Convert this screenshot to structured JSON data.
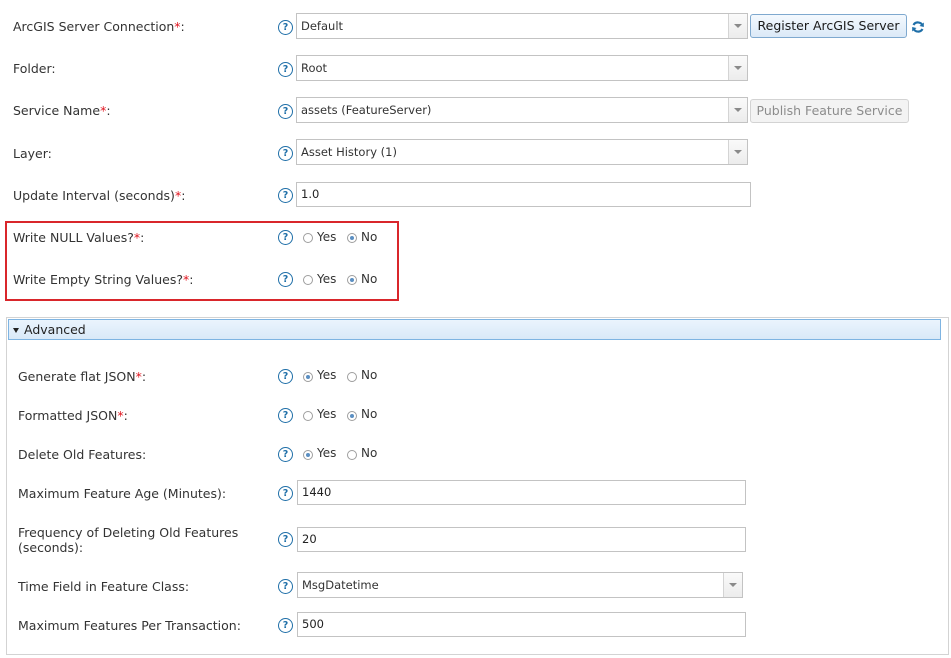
{
  "fields": {
    "server_connection": {
      "label": "ArcGIS Server Connection",
      "required": "*",
      "suffix": ":",
      "value": "Default",
      "button": "Register ArcGIS Server"
    },
    "folder": {
      "label": "Folder:",
      "value": "Root"
    },
    "service_name": {
      "label": "Service Name",
      "required": "*",
      "suffix": ":",
      "value": "assets (FeatureServer)",
      "button": "Publish Feature Service"
    },
    "layer": {
      "label": "Layer:",
      "value": "Asset History (1)"
    },
    "update_interval": {
      "label": "Update Interval (seconds)",
      "required": "*",
      "suffix": ":",
      "value": "1.0"
    },
    "write_null": {
      "label": "Write NULL Values?",
      "required": "*",
      "suffix": ":",
      "yes": "Yes",
      "no": "No",
      "selected": "No"
    },
    "write_empty": {
      "label": "Write Empty String Values?",
      "required": "*",
      "suffix": ":",
      "yes": "Yes",
      "no": "No",
      "selected": "No"
    }
  },
  "advanced": {
    "title": "Advanced",
    "flat_json": {
      "label": "Generate flat JSON",
      "required": "*",
      "suffix": ":",
      "yes": "Yes",
      "no": "No",
      "selected": "Yes"
    },
    "formatted_json": {
      "label": "Formatted JSON",
      "required": "*",
      "suffix": ":",
      "yes": "Yes",
      "no": "No",
      "selected": "No"
    },
    "delete_old": {
      "label": "Delete Old Features:",
      "yes": "Yes",
      "no": "No",
      "selected": "Yes"
    },
    "max_age": {
      "label": "Maximum Feature Age (Minutes):",
      "value": "1440"
    },
    "delete_freq": {
      "label_line1": "Frequency of Deleting Old Features",
      "label_line2": "(seconds):",
      "value": "20"
    },
    "time_field": {
      "label": "Time Field in Feature Class:",
      "value": "MsgDatetime"
    },
    "max_per_txn": {
      "label": "Maximum Features Per Transaction:",
      "value": "500"
    }
  },
  "help_glyph": "?",
  "icons": {
    "help": "help-icon",
    "refresh": "refresh-icon",
    "dropdown": "chevron-down-icon",
    "collapse": "triangle-down-icon"
  },
  "colors": {
    "required": "#e0141e",
    "highlight_border": "#d9262b",
    "accent": "#1f6fa8",
    "advanced_bar": "#d9e9f8"
  }
}
